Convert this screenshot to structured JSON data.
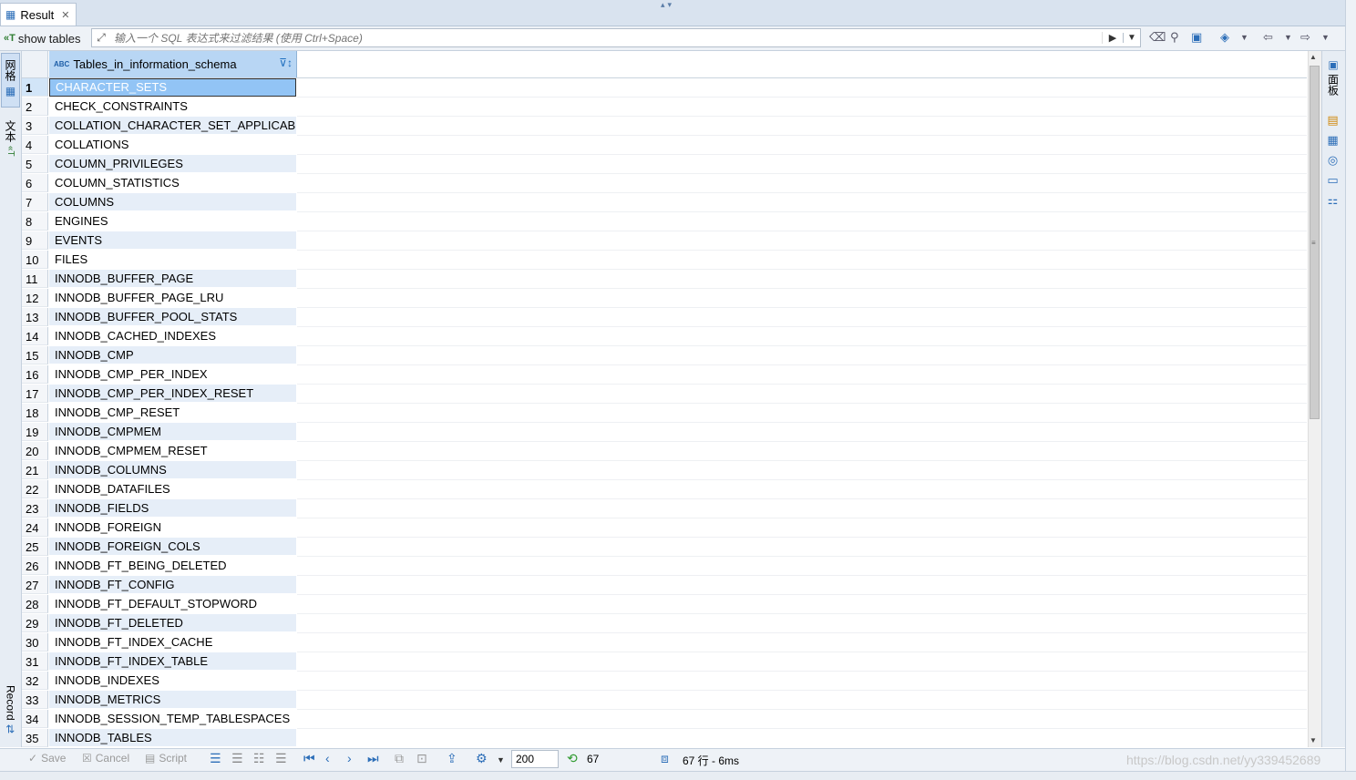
{
  "tab": {
    "title": "Result",
    "close": "✕"
  },
  "filter": {
    "query_label": "show tables",
    "query_icon": "«T",
    "placeholder": "输入一个 SQL 表达式来过滤结果 (使用 Ctrl+Space)"
  },
  "left_tabs": {
    "grid": "网格",
    "text": "文本",
    "record": "Record"
  },
  "right_tabs": {
    "panel": "面板"
  },
  "grid": {
    "column": {
      "type_badge": "ABC",
      "name": "Tables_in_information_schema"
    },
    "selected_row": 1,
    "rows": [
      {
        "n": "1",
        "v": "CHARACTER_SETS"
      },
      {
        "n": "2",
        "v": "CHECK_CONSTRAINTS"
      },
      {
        "n": "3",
        "v": "COLLATION_CHARACTER_SET_APPLICABILITY"
      },
      {
        "n": "4",
        "v": "COLLATIONS"
      },
      {
        "n": "5",
        "v": "COLUMN_PRIVILEGES"
      },
      {
        "n": "6",
        "v": "COLUMN_STATISTICS"
      },
      {
        "n": "7",
        "v": "COLUMNS"
      },
      {
        "n": "8",
        "v": "ENGINES"
      },
      {
        "n": "9",
        "v": "EVENTS"
      },
      {
        "n": "10",
        "v": "FILES"
      },
      {
        "n": "11",
        "v": "INNODB_BUFFER_PAGE"
      },
      {
        "n": "12",
        "v": "INNODB_BUFFER_PAGE_LRU"
      },
      {
        "n": "13",
        "v": "INNODB_BUFFER_POOL_STATS"
      },
      {
        "n": "14",
        "v": "INNODB_CACHED_INDEXES"
      },
      {
        "n": "15",
        "v": "INNODB_CMP"
      },
      {
        "n": "16",
        "v": "INNODB_CMP_PER_INDEX"
      },
      {
        "n": "17",
        "v": "INNODB_CMP_PER_INDEX_RESET"
      },
      {
        "n": "18",
        "v": "INNODB_CMP_RESET"
      },
      {
        "n": "19",
        "v": "INNODB_CMPMEM"
      },
      {
        "n": "20",
        "v": "INNODB_CMPMEM_RESET"
      },
      {
        "n": "21",
        "v": "INNODB_COLUMNS"
      },
      {
        "n": "22",
        "v": "INNODB_DATAFILES"
      },
      {
        "n": "23",
        "v": "INNODB_FIELDS"
      },
      {
        "n": "24",
        "v": "INNODB_FOREIGN"
      },
      {
        "n": "25",
        "v": "INNODB_FOREIGN_COLS"
      },
      {
        "n": "26",
        "v": "INNODB_FT_BEING_DELETED"
      },
      {
        "n": "27",
        "v": "INNODB_FT_CONFIG"
      },
      {
        "n": "28",
        "v": "INNODB_FT_DEFAULT_STOPWORD"
      },
      {
        "n": "29",
        "v": "INNODB_FT_DELETED"
      },
      {
        "n": "30",
        "v": "INNODB_FT_INDEX_CACHE"
      },
      {
        "n": "31",
        "v": "INNODB_FT_INDEX_TABLE"
      },
      {
        "n": "32",
        "v": "INNODB_INDEXES"
      },
      {
        "n": "33",
        "v": "INNODB_METRICS"
      },
      {
        "n": "34",
        "v": "INNODB_SESSION_TEMP_TABLESPACES"
      },
      {
        "n": "35",
        "v": "INNODB_TABLES"
      }
    ]
  },
  "bottom": {
    "save": "Save",
    "cancel": "Cancel",
    "script": "Script",
    "page_size": "200",
    "row_count": "67",
    "status": "67 行 - 6ms",
    "watermark": "https://blog.csdn.net/yy339452689"
  },
  "colors": {
    "selected": "#92c4f5",
    "header": "#b8d6f4",
    "stripe": "#e6eef8"
  }
}
